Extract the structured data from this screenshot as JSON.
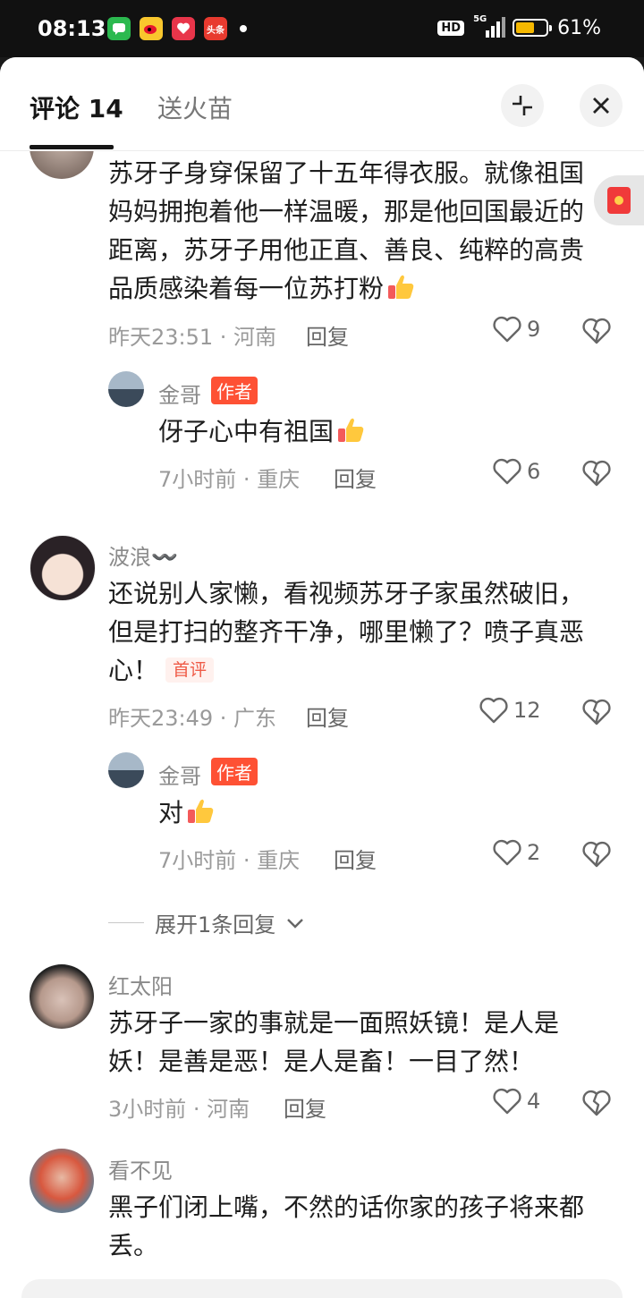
{
  "status_bar": {
    "time": "08:13",
    "hd": "HD",
    "network": "5G",
    "battery_percent_text": "61%",
    "battery_level": 0.61,
    "app_icons": [
      "messages-icon",
      "weibo-icon",
      "app-icon",
      "toutiao-icon"
    ],
    "toutiao_label": "头条"
  },
  "tabs": {
    "comments_label": "评论 14",
    "fire_label": "送火苗"
  },
  "comments": [
    {
      "text": "苏牙子身穿保留了十五年得衣服。就像祖国妈妈拥抱着他一样温暖，那是他回国最近的距离，苏牙子用他正直、善良、纯粹的高贵品质感染着每一位苏打粉",
      "meta": "昨天23:51 · 河南",
      "reply": "回复",
      "likes": "9"
    },
    {
      "username": "金哥",
      "tag": "作者",
      "text": "伢子心中有祖国",
      "meta": "7小时前 · 重庆",
      "reply": "回复",
      "likes": "6"
    },
    {
      "username": "波浪〰️",
      "text": "还说别人家懒，看视频苏牙子家虽然破旧，但是打扫的整齐干净，哪里懒了？喷子真恶心！",
      "first_tag": "首评",
      "meta": "昨天23:49 · 广东",
      "reply": "回复",
      "likes": "12"
    },
    {
      "username": "金哥",
      "tag": "作者",
      "text": "对",
      "meta": "7小时前 · 重庆",
      "reply": "回复",
      "likes": "2"
    },
    {
      "username": "红太阳",
      "text": "苏牙子一家的事就是一面照妖镜！是人是妖！是善是恶！是人是畜！一目了然！",
      "meta": "3小时前 · 河南",
      "reply": "回复",
      "likes": "4"
    },
    {
      "username": "看不见",
      "text": "黑子们闭上嘴，不然的话你家的孩子将来都丢。"
    }
  ],
  "expand_replies_label": "展开1条回复",
  "colors": {
    "author_tag": "#fe5134",
    "first_tag_text": "#ef5a46",
    "redpacket": "#f03a3a"
  }
}
